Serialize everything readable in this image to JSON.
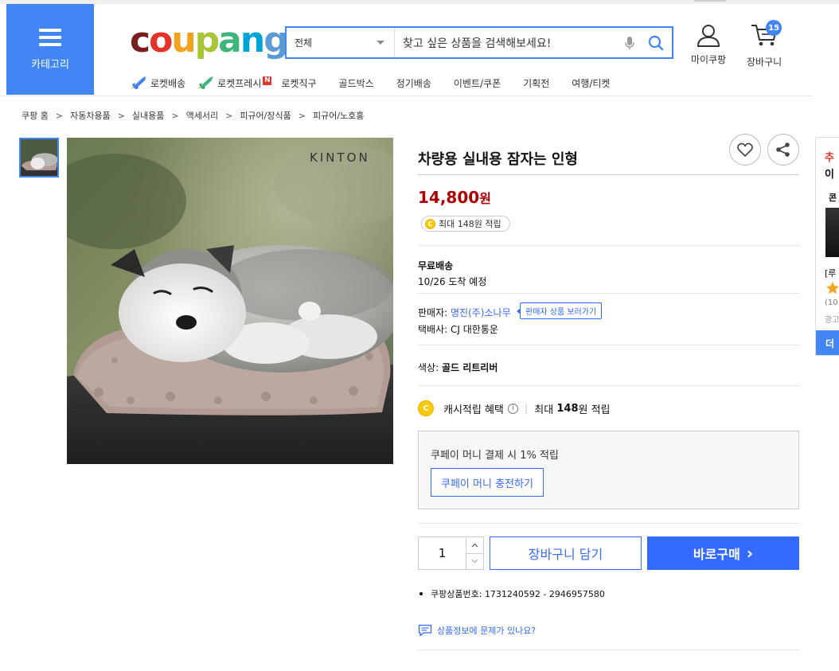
{
  "header": {
    "category_label": "카테고리",
    "logo_letters": [
      "c",
      "o",
      "u",
      "p",
      "a",
      "n",
      "g"
    ],
    "search_category": "전체",
    "search_placeholder": "찾고 싶은 상품을 검색해보세요!",
    "mycoupang_label": "마이쿠팡",
    "cart_label": "장바구니",
    "cart_count": "15"
  },
  "nav": {
    "items": [
      "로켓배송",
      "로켓프레시",
      "로켓직구",
      "골드박스",
      "정기배송",
      "이벤트/쿠폰",
      "기획전",
      "여행/티켓"
    ],
    "fresh_badge": "N"
  },
  "breadcrumb": [
    "쿠팡 홈",
    "자동차용품",
    "실내용품",
    "액세서리",
    "피규어/장식품",
    "피규어/노호홍"
  ],
  "product": {
    "image_brand": "KINTON",
    "title": "차량용 실내용 잠자는 인형",
    "price": "14,800",
    "price_unit": "원",
    "reward_coin": "C",
    "reward_text": "최대 148원 적립",
    "shipping_title": "무료배송",
    "delivery_eta": "10/26 도착 예정",
    "seller_label": "판매자:",
    "seller_name": "명진(주)소나무",
    "seller_products_btn": "판매자 상품 보러가기",
    "courier_label": "택배사:",
    "courier_name": "CJ 대한통운",
    "option_label": "색상:",
    "option_value": "골드 리트리버",
    "cash_benefit": "캐시적립 혜택",
    "cash_info_icon": "i",
    "cash_max_prefix": "최대",
    "cash_max_amount": "148",
    "cash_max_suffix": "원 적립",
    "coupay_text": "쿠페이 머니 결제 시 1% 적립",
    "coupay_button": "쿠페이 머니 충전하기",
    "quantity": "1",
    "add_to_cart": "장바구니 담기",
    "buy_now": "바로구매",
    "buy_now_chevron": "›",
    "product_id_label": "쿠팡상품번호:",
    "product_id": "1731240592 - 2946957580",
    "report_link": "상품정보에 문제가 있나요?"
  },
  "side_rail": {
    "line1": "추",
    "line2": "이",
    "line3": "콘",
    "line4": "[루",
    "line5": "(10",
    "line6": "광고",
    "more": "더"
  },
  "colors": {
    "brand_blue": "#4285f4",
    "cta_blue": "#346aff",
    "price_red": "#ae0000",
    "logo_c": "#7a1f1f",
    "logo_o": "#e5332a",
    "logo_u": "#f2a21b",
    "logo_p": "#a8c536",
    "logo_a": "#3fb57c",
    "logo_n": "#00a3d9",
    "logo_g": "#5a9bd4"
  }
}
